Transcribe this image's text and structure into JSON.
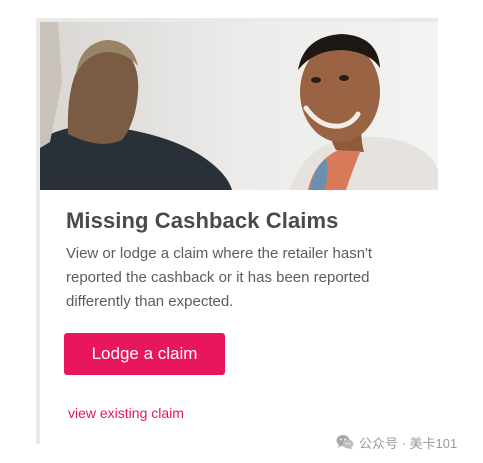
{
  "card": {
    "title": "Missing Cashback Claims",
    "description": "View or lodge a claim where the retailer hasn't reported the cashback or it has been reported differently than expected.",
    "primary_button_label": "Lodge a claim",
    "secondary_link_label": "view existing claim"
  },
  "watermark": {
    "text": "公众号 · 美卡101",
    "icon": "wechat-icon"
  },
  "colors": {
    "accent": "#e8155f",
    "title": "#4a4a4a",
    "body_text": "#5c5c5c",
    "card_border": "#e9e9e9"
  }
}
